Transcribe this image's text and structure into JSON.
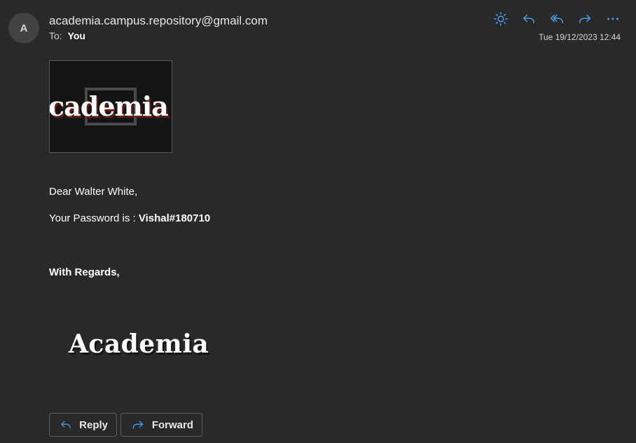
{
  "header": {
    "avatar_initial": "A",
    "sender": "academia.campus.repository@gmail.com",
    "to_label": "To:",
    "to_name": "You",
    "date": "Tue 19/12/2023 12:44"
  },
  "toolbar": {
    "icons": [
      "sun-icon",
      "reply-icon",
      "reply-all-icon",
      "forward-icon",
      "more-icon"
    ]
  },
  "body": {
    "banner_logo_text": "cademia",
    "greeting": "Dear Walter White,",
    "password_label": "Your Password is : ",
    "password_value": "Vishal#180710",
    "regards": "With Regards,",
    "signature_logo_text": "Academia"
  },
  "actions": {
    "reply_label": "Reply",
    "forward_label": "Forward"
  },
  "colors": {
    "background": "#292929",
    "accent_icon": "#4aa0f5",
    "text": "#ffffff"
  }
}
